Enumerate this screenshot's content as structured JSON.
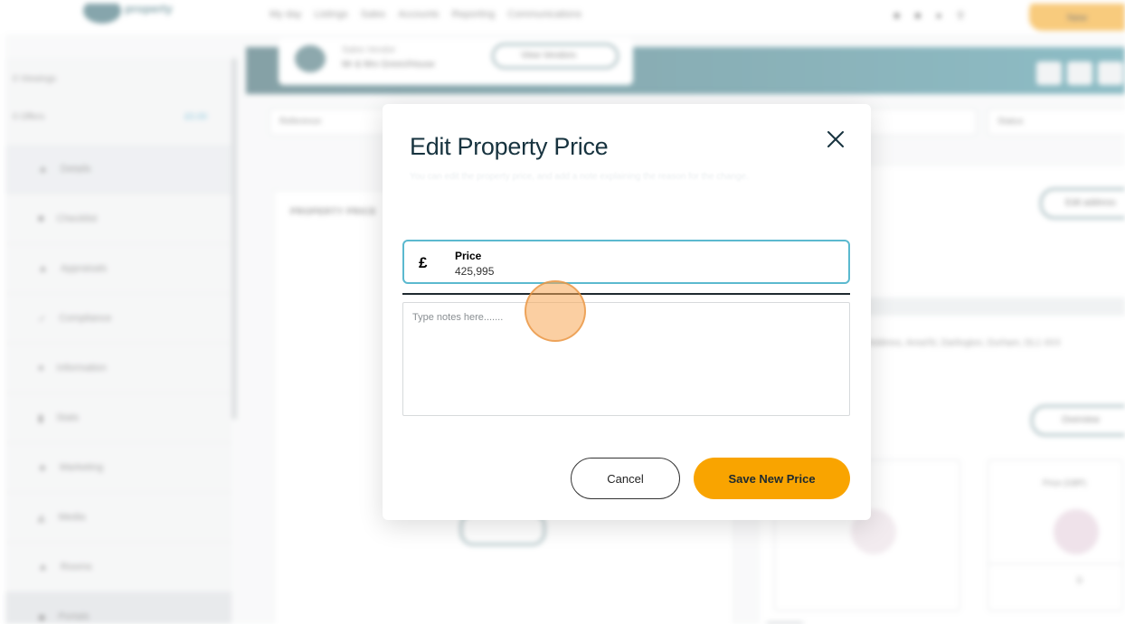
{
  "background": {
    "logo_text": "property",
    "nav": [
      "My day",
      "Listings",
      "Sales",
      "Accounts",
      "Reporting",
      "Communications"
    ],
    "top_button_label": "New",
    "sidebar": {
      "stats": [
        {
          "label": "0 Viewings"
        },
        {
          "label": "0 Offers",
          "count": "£0.00"
        }
      ],
      "items": [
        {
          "label": "Details",
          "icon": "home-icon",
          "active": true
        },
        {
          "label": "Checklist",
          "icon": "checklist-icon"
        },
        {
          "label": "Appraisals",
          "icon": "appraisal-icon"
        },
        {
          "label": "Compliance",
          "icon": "compliance-icon"
        },
        {
          "label": "Information",
          "icon": "info-icon"
        },
        {
          "label": "Stats",
          "icon": "stats-icon"
        },
        {
          "label": "Marketing",
          "icon": "marketing-icon"
        },
        {
          "label": "Media",
          "icon": "media-icon"
        },
        {
          "label": "Rooms",
          "icon": "rooms-icon"
        },
        {
          "label": "Portals",
          "icon": "portals-icon",
          "bottom_active": true
        }
      ]
    },
    "header_card": {
      "line1": "Sales Vendor",
      "line2": "Mr & Mrs Green/House",
      "button": "View Vendors"
    },
    "filters": [
      {
        "label": "Reference"
      },
      {
        "label": ""
      },
      {
        "label": "Status"
      }
    ],
    "left_panel_title": "PROPERTY PRICE",
    "right_panel": {
      "button1": "Edit address",
      "address": "Address, Area/St, Darlington, Durham, DL1 4XX",
      "button2": "Overview",
      "box2_label": "Price (GBP)",
      "box2_number": "0"
    }
  },
  "modal": {
    "title": "Edit Property Price",
    "subtitle": "You can edit the property price, and add a note explaining the reason for the change.",
    "price_field": {
      "currency_symbol": "£",
      "label": "Price",
      "value": "425,995"
    },
    "notes": {
      "placeholder": "Type notes here......."
    },
    "cancel_label": "Cancel",
    "save_label": "Save New Price"
  },
  "colors": {
    "accent_teal": "#5bb9cf",
    "primary_orange": "#f9a400",
    "title_navy": "#17333f",
    "header_teal": "#2e5d66"
  }
}
